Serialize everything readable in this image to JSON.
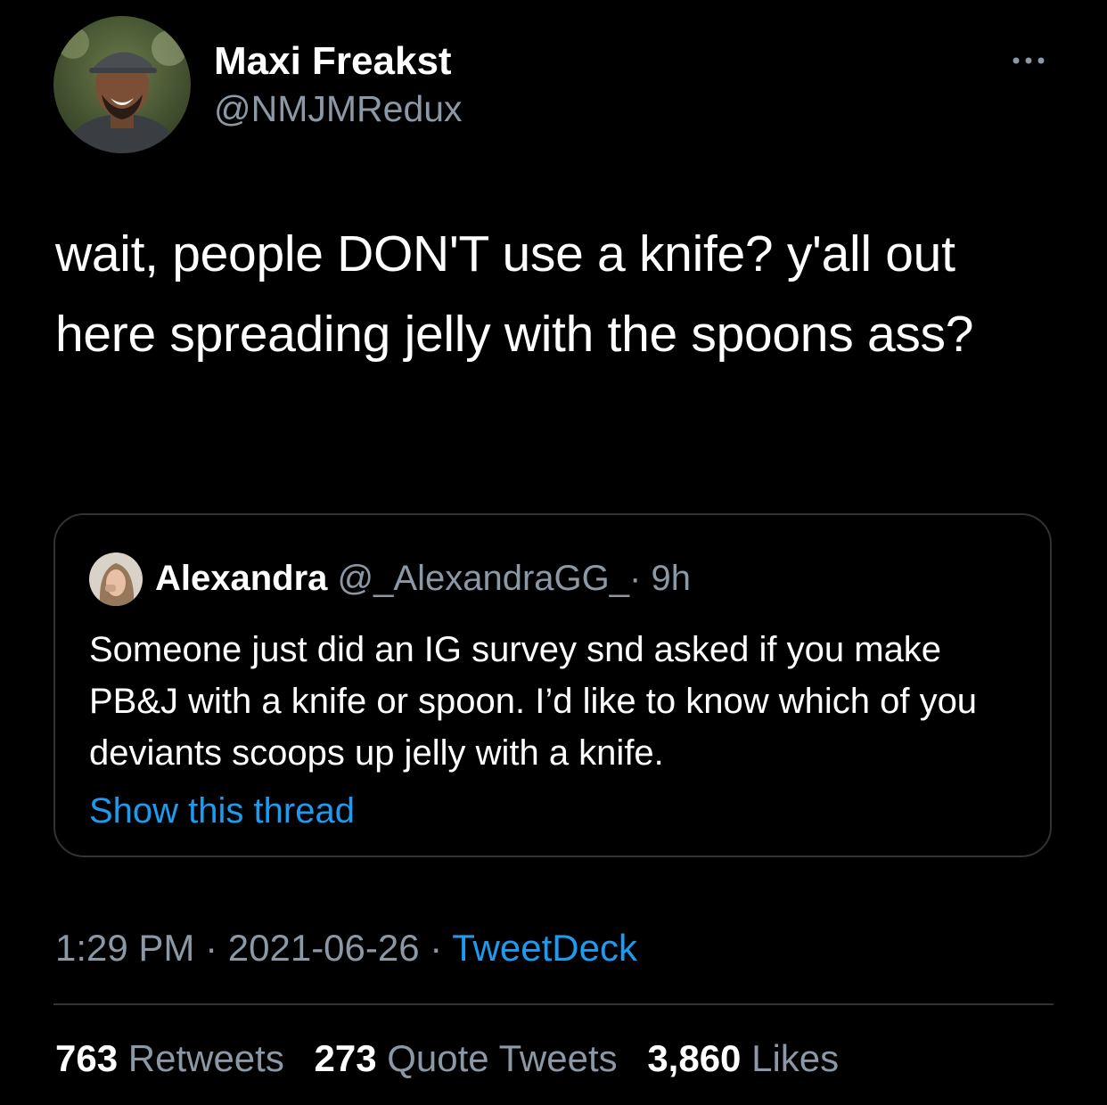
{
  "author": {
    "display_name": "Maxi Freakst",
    "handle": "@NMJMRedux"
  },
  "tweet": {
    "text": "wait, people DON'T use a knife? y'all out here spreading jelly with the spoons ass?"
  },
  "quoted": {
    "name": "Alexandra",
    "handle": "@_AlexandraGG_",
    "separator": "·",
    "time": "9h",
    "text": "Someone just did an IG survey snd asked if you make PB&J with a knife or spoon. I’d like to know which of you deviants scoops up jelly with a knife.",
    "show_thread": "Show this thread"
  },
  "meta": {
    "time": "1:29 PM",
    "separator": "·",
    "date": "2021-06-26",
    "source": "TweetDeck"
  },
  "stats": {
    "retweets_count": "763",
    "retweets_label": "Retweets",
    "quotes_count": "273",
    "quotes_label": "Quote Tweets",
    "likes_count": "3,860",
    "likes_label": "Likes"
  },
  "icons": {
    "more": "more-horizontal-icon"
  },
  "colors": {
    "background": "#000000",
    "text_primary": "#ffffff",
    "text_secondary": "#8b98a5",
    "link": "#1d9bf0",
    "border": "#2f3336"
  }
}
